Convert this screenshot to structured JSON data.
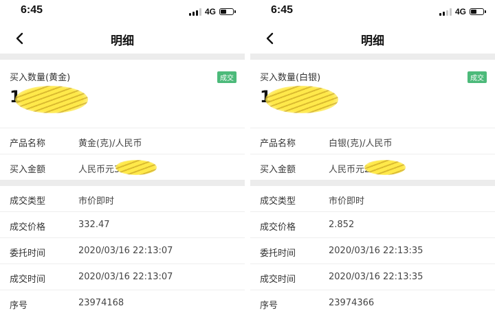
{
  "screens": [
    {
      "status": {
        "time": "6:45",
        "network": "4G",
        "battery_level": 0.55
      },
      "nav": {
        "title": "明细"
      },
      "summary": {
        "label": "买入数量(黄金)",
        "badge": "成交",
        "value": "1"
      },
      "info": [
        {
          "label": "产品名称",
          "value": "黄金(克)/人民币"
        },
        {
          "label": "买入金额",
          "value": "人民币元3"
        }
      ],
      "details": [
        {
          "label": "成交类型",
          "value": "市价即时"
        },
        {
          "label": "成交价格",
          "value": "332.47"
        },
        {
          "label": "委托时间",
          "value": "2020/03/16 22:13:07"
        },
        {
          "label": "成交时间",
          "value": "2020/03/16 22:13:07"
        },
        {
          "label": "序号",
          "value": "23974168"
        }
      ]
    },
    {
      "status": {
        "time": "6:45",
        "network": "4G",
        "battery_level": 0.55
      },
      "nav": {
        "title": "明细"
      },
      "summary": {
        "label": "买入数量(白银)",
        "badge": "成交",
        "value": "1"
      },
      "info": [
        {
          "label": "产品名称",
          "value": "白银(克)/人民币"
        },
        {
          "label": "买入金额",
          "value": "人民币元2"
        }
      ],
      "details": [
        {
          "label": "成交类型",
          "value": "市价即时"
        },
        {
          "label": "成交价格",
          "value": "2.852"
        },
        {
          "label": "委托时间",
          "value": "2020/03/16 22:13:35"
        },
        {
          "label": "成交时间",
          "value": "2020/03/16 22:13:35"
        },
        {
          "label": "序号",
          "value": "23974366"
        }
      ]
    }
  ],
  "colors": {
    "badge": "#4cba7a",
    "separator": "#ececec",
    "redaction": "#ffe94a"
  },
  "icons": {
    "back": "chevron-left-icon",
    "signal": "signal-icon",
    "battery": "battery-icon"
  }
}
